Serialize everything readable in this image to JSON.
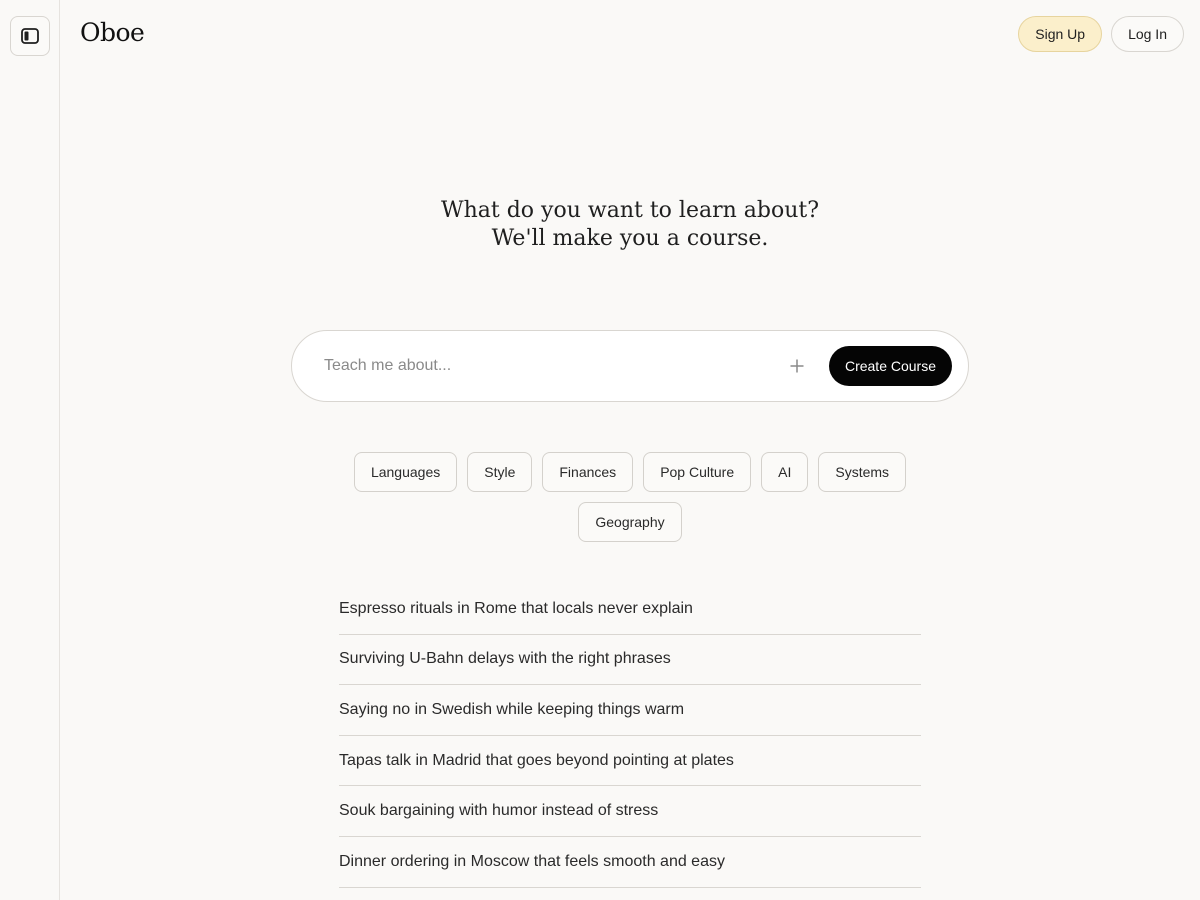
{
  "header": {
    "logo": "Oboe",
    "signup_label": "Sign Up",
    "login_label": "Log In"
  },
  "sidebar": {
    "toggle_icon": "sidebar-panel-icon"
  },
  "hero": {
    "line1": "What do you want to learn about?",
    "line2": "We'll make you a course."
  },
  "search": {
    "placeholder": "Teach me about...",
    "value": "",
    "add_icon": "plus-icon",
    "submit_label": "Create Course"
  },
  "categories": [
    "Languages",
    "Style",
    "Finances",
    "Pop Culture",
    "AI",
    "Systems",
    "Geography"
  ],
  "suggestions": [
    "Espresso rituals in Rome that locals never explain",
    "Surviving U-Bahn delays with the right phrases",
    "Saying no in Swedish while keeping things warm",
    "Tapas talk in Madrid that goes beyond pointing at plates",
    "Souk bargaining with humor instead of stress",
    "Dinner ordering in Moscow that feels smooth and easy"
  ],
  "colors": {
    "background": "#faf9f7",
    "signup_bg": "#fbefcb",
    "primary_button": "#050505",
    "border": "#d9d6d1"
  }
}
